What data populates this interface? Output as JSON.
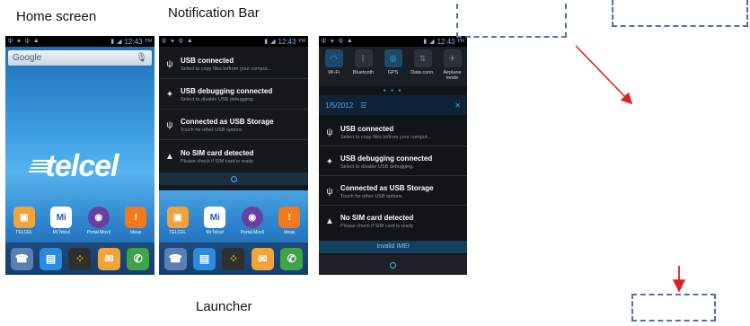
{
  "captions": {
    "home": "Home screen",
    "notification": "Notification Bar",
    "launcher": "Launcher"
  },
  "statusbar": {
    "time": "12:43",
    "ampm": "PM"
  },
  "home": {
    "search_label": "Google",
    "logo": "telcel",
    "apps": [
      {
        "label": "TELCEL",
        "icon": "telcel-sim-icon",
        "color": "#f2a33a"
      },
      {
        "label": "Mi Telcel",
        "icon": "mi-telcel-icon",
        "color": "#2f7fd0",
        "text": "Mi"
      },
      {
        "label": "Portal Movil",
        "icon": "portal-movil-icon",
        "color": "#6a3fa0"
      },
      {
        "label": "Ideas",
        "icon": "ideas-icon",
        "color": "#f27a1a"
      }
    ],
    "dock": [
      {
        "icon": "phone-contacts-icon",
        "color": "#5a7fb5"
      },
      {
        "icon": "contacts-icon",
        "color": "#2a8be0"
      },
      {
        "icon": "apps-grid-icon",
        "color": "#3a3a3a"
      },
      {
        "icon": "mail-icon",
        "color": "#f2a33a"
      },
      {
        "icon": "dialer-icon",
        "color": "#3fa34a"
      }
    ]
  },
  "notifications": [
    {
      "title": "USB connected",
      "sub": "Select to copy files to/from your comput...",
      "icon": "usb-icon"
    },
    {
      "title": "USB debugging connected",
      "sub": "Select to disable USB debugging.",
      "icon": "android-debug-icon"
    },
    {
      "title": "Connected as USB Storage",
      "sub": "Touch for other USB options",
      "icon": "usb-icon"
    },
    {
      "title": "No SIM card detected",
      "sub": "Please check if SIM card is ready",
      "icon": "warning-icon"
    }
  ],
  "quick_settings": [
    {
      "label": "Wi-Fi",
      "on": true,
      "icon": "wifi-icon"
    },
    {
      "label": "Bluetooth",
      "on": false,
      "icon": "bluetooth-icon"
    },
    {
      "label": "GPS",
      "on": true,
      "icon": "gps-icon"
    },
    {
      "label": "Data conn.",
      "on": false,
      "icon": "data-connection-icon"
    },
    {
      "label": "Airplane mode",
      "on": false,
      "icon": "airplane-icon"
    }
  ],
  "launcher": {
    "date": "1/5/2012",
    "imei": "Invalid IMEI"
  },
  "annotation_color": "#e02020"
}
